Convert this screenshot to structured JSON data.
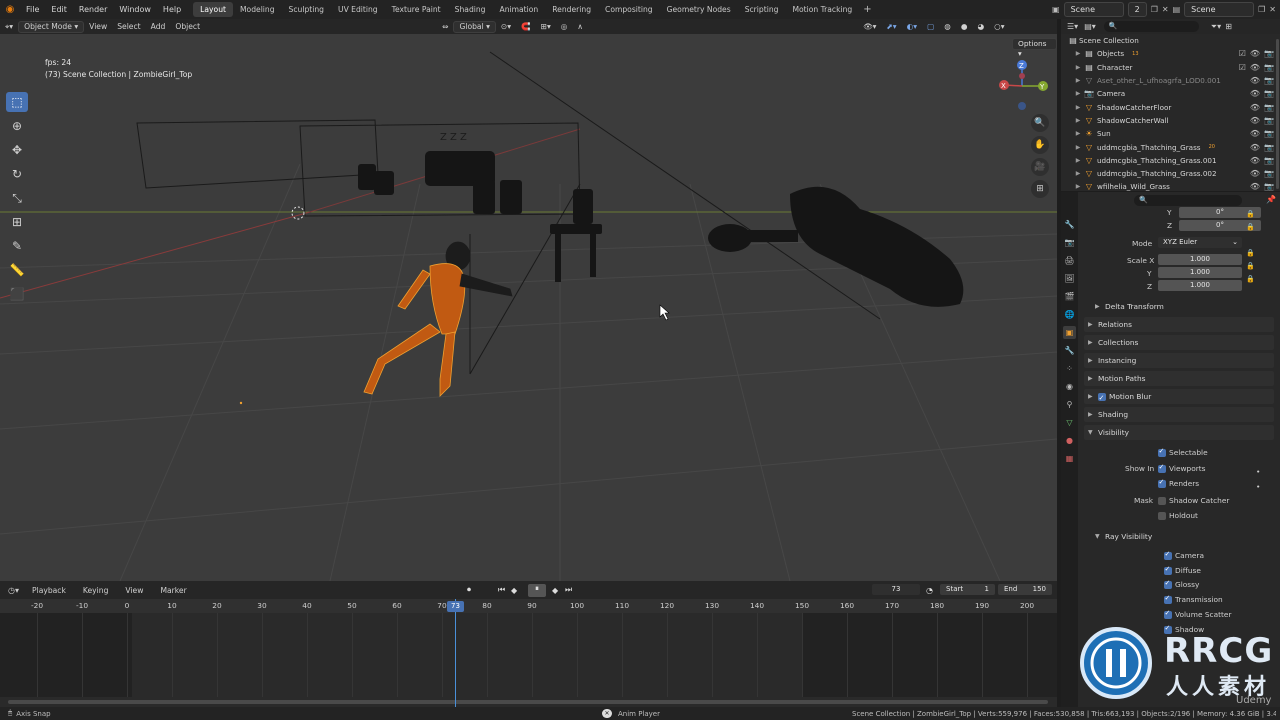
{
  "topbar": {
    "menus": [
      "File",
      "Edit",
      "Render",
      "Window",
      "Help"
    ],
    "workspaces": [
      "Layout",
      "Modeling",
      "Sculpting",
      "UV Editing",
      "Texture Paint",
      "Shading",
      "Animation",
      "Rendering",
      "Compositing",
      "Geometry Nodes",
      "Scripting",
      "Motion Tracking"
    ],
    "active_workspace": "Layout",
    "add_tab": "+",
    "scene_name": "Scene",
    "scene_users": "2",
    "view_layer": "Scene"
  },
  "viewport_header": {
    "mode": "Object Mode",
    "menus": [
      "View",
      "Select",
      "Add",
      "Object"
    ],
    "transform_orientation": "Global",
    "options_label": "Options"
  },
  "viewport": {
    "fps_text": "fps: 24",
    "collection_text": "(73) Scene Collection | ZombieGirl_Top",
    "zz_label": "Z Z Z"
  },
  "gizmo": {
    "x": "X",
    "y": "Y",
    "z": "Z"
  },
  "outliner": {
    "root": "Scene Collection",
    "items": [
      {
        "name": "Objects",
        "badge": "13"
      },
      {
        "name": "Character",
        "badge": ""
      },
      {
        "name": "Aset_other_L_ufhoagrfa_LOD0.001",
        "badge": ""
      },
      {
        "name": "Camera",
        "badge": ""
      },
      {
        "name": "ShadowCatcherFloor",
        "badge": ""
      },
      {
        "name": "ShadowCatcherWall",
        "badge": ""
      },
      {
        "name": "Sun",
        "badge": ""
      },
      {
        "name": "uddmcgbia_Thatching_Grass",
        "badge": "20"
      },
      {
        "name": "uddmcgbia_Thatching_Grass.001",
        "badge": ""
      },
      {
        "name": "uddmcgbia_Thatching_Grass.002",
        "badge": ""
      },
      {
        "name": "wfilhelia_Wild_Grass",
        "badge": ""
      }
    ]
  },
  "properties": {
    "rotation_y_label": "Y",
    "rotation_y": "0°",
    "rotation_z_label": "Z",
    "rotation_z": "0°",
    "mode_label": "Mode",
    "mode_value": "XYZ Euler",
    "scale_x_label": "Scale X",
    "scale_x": "1.000",
    "scale_y_label": "Y",
    "scale_y": "1.000",
    "scale_z_label": "Z",
    "scale_z": "1.000",
    "delta_transform": "Delta Transform",
    "panels": [
      "Relations",
      "Collections",
      "Instancing",
      "Motion Paths",
      "Motion Blur",
      "Shading",
      "Visibility"
    ],
    "selectable": "Selectable",
    "show_in_label": "Show In",
    "viewports": "Viewports",
    "renders": "Renders",
    "mask_label": "Mask",
    "shadow_catcher": "Shadow Catcher",
    "holdout": "Holdout",
    "ray_visibility": "Ray Visibility",
    "ray_items": [
      "Camera",
      "Diffuse",
      "Glossy",
      "Transmission",
      "Volume Scatter",
      "Shadow"
    ]
  },
  "timeline": {
    "menus": [
      "Playback",
      "Keying",
      "View",
      "Marker"
    ],
    "current_frame": "73",
    "start_label": "Start",
    "start": "1",
    "end_label": "End",
    "end": "150",
    "ruler": [
      "-20",
      "-10",
      "0",
      "10",
      "20",
      "30",
      "40",
      "50",
      "60",
      "70",
      "80",
      "90",
      "100",
      "110",
      "120",
      "130",
      "140",
      "150",
      "160",
      "170",
      "180",
      "190",
      "200"
    ],
    "playhead_label": "73"
  },
  "statusbar": {
    "left": "Axis Snap",
    "center": "Anim Player",
    "right": "Scene Collection | ZombieGirl_Top | Verts:559,976 | Faces:530,858 | Tris:663,193 | Objects:2/196 | Memory: 4.36 GiB | 3.4"
  },
  "watermark": {
    "brand": "RRCG",
    "sub": "人人素材",
    "udemy": "Udemy"
  },
  "colors": {
    "accent": "#4772b3",
    "selected_orange": "#f0a030",
    "viewport_bg": "#3c3c3c"
  }
}
